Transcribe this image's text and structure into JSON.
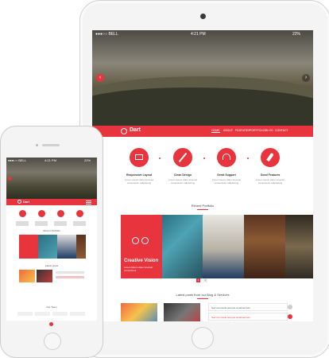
{
  "ipad": {
    "status": {
      "carrier": "●●●○○ BELL",
      "time": "4:21 PM",
      "battery": "22%"
    },
    "brand": "Dart",
    "menu": [
      "HOME",
      "ABOUT",
      "FEATURES",
      "PORTFOLIO",
      "BLOG",
      "CONTACT"
    ],
    "features": [
      {
        "title": "Responsive Layout",
        "text": "Lorem ipsum dolor sit amet consectetur adipisicing"
      },
      {
        "title": "Clean Design",
        "text": "Lorem ipsum dolor sit amet consectetur adipisicing"
      },
      {
        "title": "Great Support",
        "text": "Lorem ipsum dolor sit amet consectetur adipisicing"
      },
      {
        "title": "Good Features",
        "text": "Lorem ipsum dolor sit amet consectetur adipisicing"
      }
    ],
    "portfolio_title": "Recent Portfolio",
    "tile_title": "Creative Vision",
    "tile_sub": "Lorem ipsum dolor sit amet consectetur",
    "pages": [
      "1",
      "2"
    ],
    "blog_title": "Latest posts from our Blog & Services",
    "blog_rows": [
      "Sed commodo tempus condimentum",
      "Sed commodo tempus condimentum"
    ]
  },
  "iphone": {
    "status": {
      "carrier": "●●●○○ BELL",
      "time": "4:21 PM",
      "battery": "22%"
    },
    "brand": "Dart",
    "section1": "Recent Portfolio",
    "section2": "Latest posts",
    "section3": "Our Team"
  },
  "colors": {
    "accent": "#e8343c"
  }
}
